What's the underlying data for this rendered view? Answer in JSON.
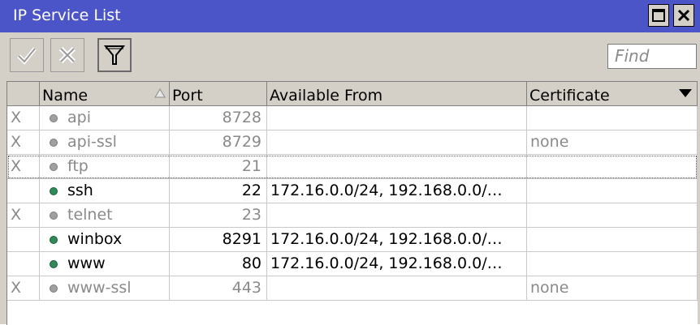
{
  "window": {
    "title": "IP Service List"
  },
  "toolbar": {
    "find_placeholder": "Find"
  },
  "columns": [
    "Name",
    "Port",
    "Available From",
    "Certificate"
  ],
  "rows": [
    {
      "flag": "X",
      "name": "api",
      "port": "8728",
      "available_from": "",
      "certificate": "",
      "disabled": true
    },
    {
      "flag": "X",
      "name": "api-ssl",
      "port": "8729",
      "available_from": "",
      "certificate": "none",
      "disabled": true
    },
    {
      "flag": "X",
      "name": "ftp",
      "port": "21",
      "available_from": "",
      "certificate": "",
      "disabled": true
    },
    {
      "flag": "",
      "name": "ssh",
      "port": "22",
      "available_from": "172.16.0.0/24, 192.168.0.0/…",
      "certificate": "",
      "disabled": false
    },
    {
      "flag": "X",
      "name": "telnet",
      "port": "23",
      "available_from": "",
      "certificate": "",
      "disabled": true
    },
    {
      "flag": "",
      "name": "winbox",
      "port": "8291",
      "available_from": "172.16.0.0/24, 192.168.0.0/…",
      "certificate": "",
      "disabled": false
    },
    {
      "flag": "",
      "name": "www",
      "port": "80",
      "available_from": "172.16.0.0/24, 192.168.0.0/…",
      "certificate": "",
      "disabled": false
    },
    {
      "flag": "X",
      "name": "www-ssl",
      "port": "443",
      "available_from": "",
      "certificate": "none",
      "disabled": true
    }
  ],
  "colors": {
    "titlebar": "#4b55c8",
    "enabled_dot": "#2e8b57",
    "disabled_dot": "#a0a0a0"
  },
  "icons": {
    "enable": "check-icon",
    "disable": "cross-icon",
    "filter": "filter-icon",
    "maximize": "maximize-icon",
    "close": "close-icon",
    "sort": "sort-asc-icon",
    "columns_menu": "chevron-down-icon"
  }
}
